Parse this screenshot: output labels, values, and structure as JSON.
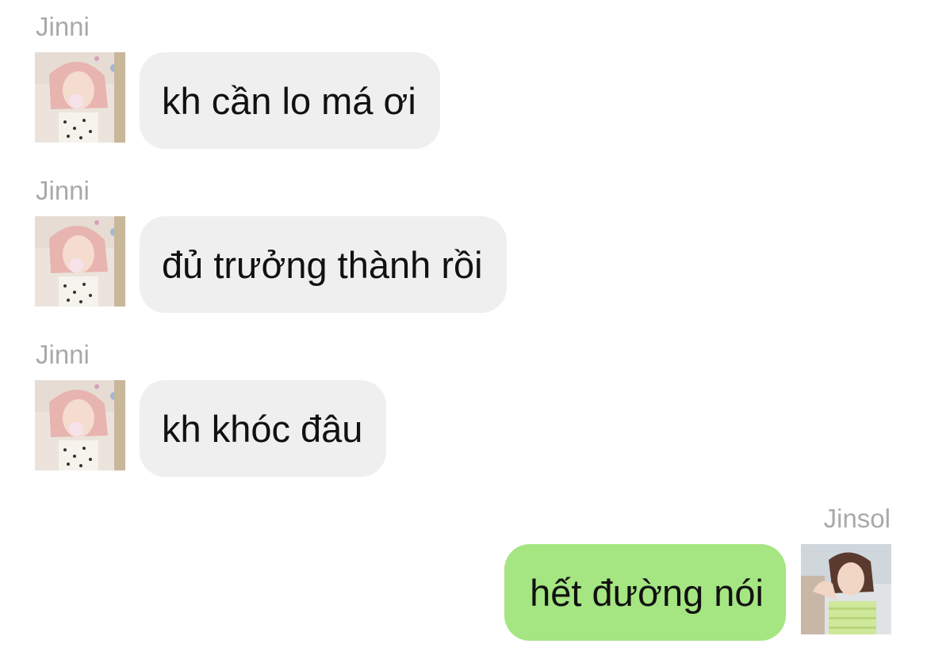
{
  "messages": [
    {
      "sender": "Jinni",
      "direction": "incoming",
      "text": "kh cần lo má ơi",
      "avatar": "avatar-jinni"
    },
    {
      "sender": "Jinni",
      "direction": "incoming",
      "text": "đủ trưởng thành rồi",
      "avatar": "avatar-jinni"
    },
    {
      "sender": "Jinni",
      "direction": "incoming",
      "text": "kh khóc đâu",
      "avatar": "avatar-jinni"
    },
    {
      "sender": "Jinsol",
      "direction": "outgoing",
      "text": "hết đường nói",
      "avatar": "avatar-jinsol"
    }
  ],
  "colors": {
    "incoming_bubble": "#efefef",
    "outgoing_bubble": "#a5e582",
    "sender_name": "#a9a9a9",
    "message_text": "#111111"
  }
}
